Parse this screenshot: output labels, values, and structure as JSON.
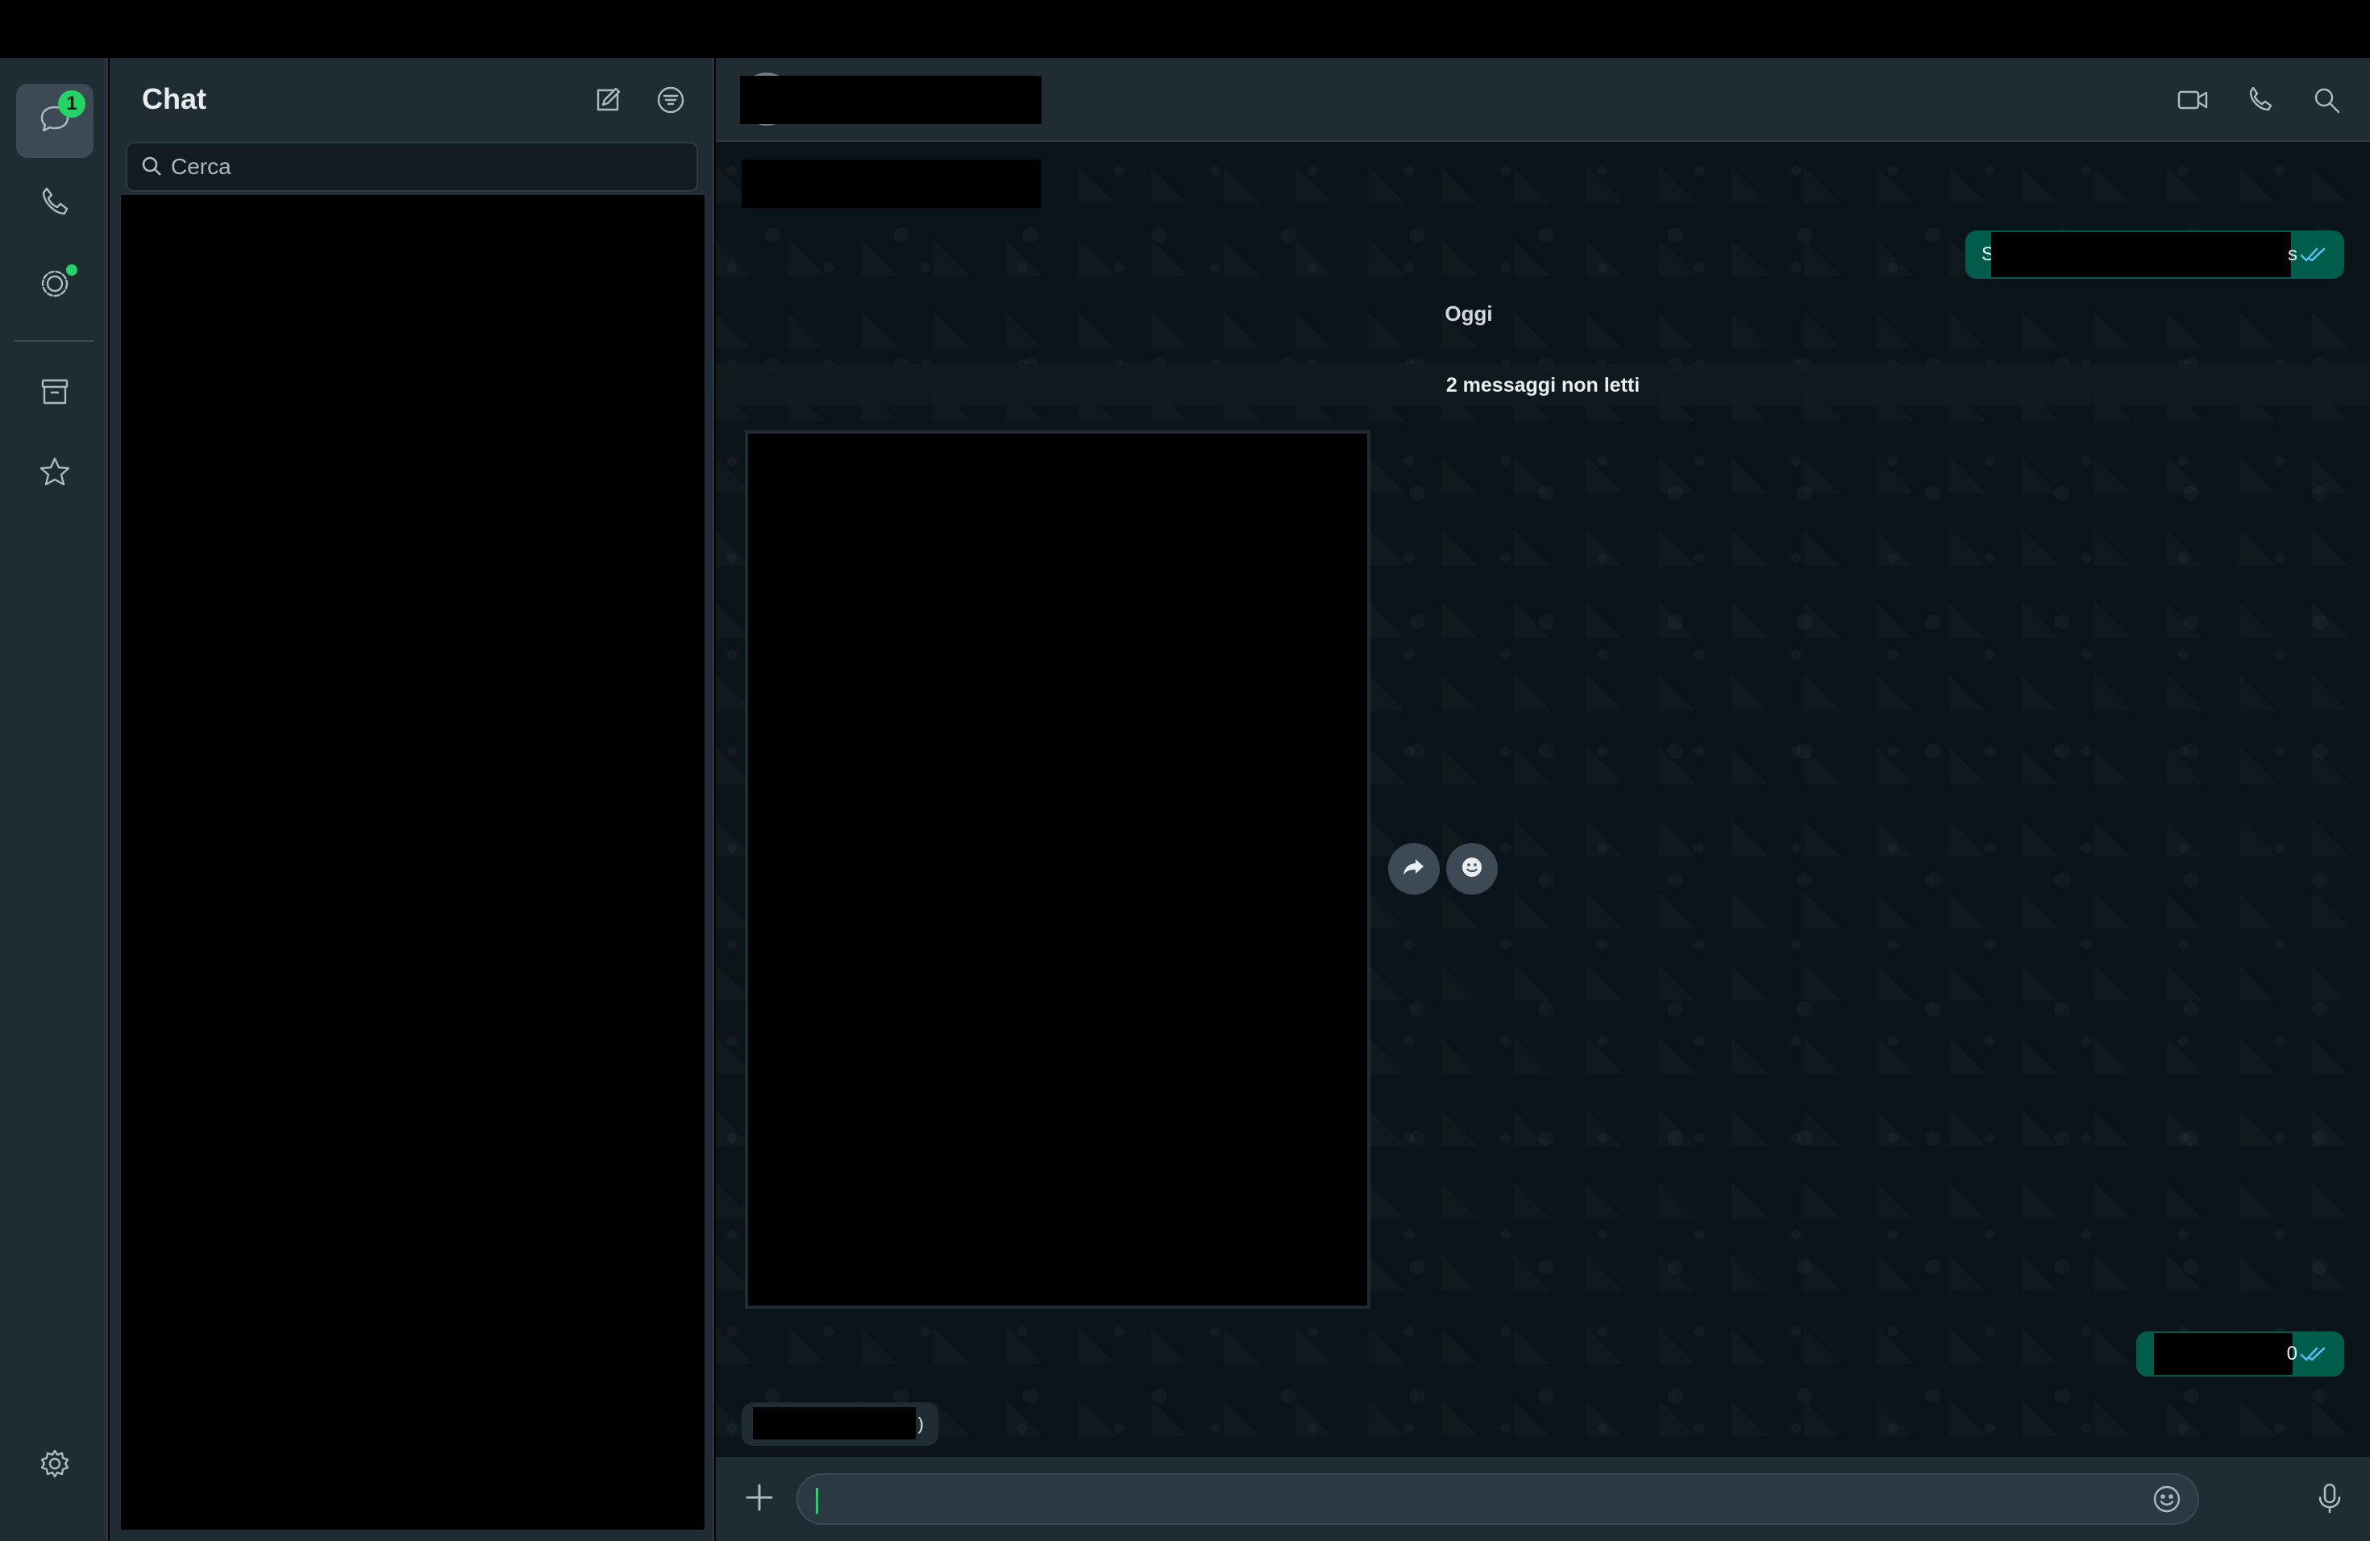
{
  "sidebar": {
    "chats_unread_badge": "1",
    "items": [
      {
        "name": "chats",
        "icon": "chat-bubble-icon"
      },
      {
        "name": "calls",
        "icon": "phone-icon"
      },
      {
        "name": "status",
        "icon": "status-ring-icon"
      },
      {
        "name": "archived",
        "icon": "archive-icon"
      },
      {
        "name": "starred",
        "icon": "star-icon"
      },
      {
        "name": "settings",
        "icon": "gear-icon"
      }
    ]
  },
  "chat_list": {
    "title": "Chat",
    "search_placeholder": "Cerca"
  },
  "conversation": {
    "date_separator": "Oggi",
    "unread_banner": "2 messaggi non letti",
    "outgoing_1_visible_start": "S",
    "outgoing_1_visible_end": "s",
    "outgoing_2_visible_end": "0",
    "incoming_1_visible_end": ")"
  },
  "colors": {
    "accent_green": "#25d366",
    "outgoing_bubble": "#005c4b",
    "read_tick_blue": "#53bdeb",
    "panel_bg": "#202c33",
    "chat_bg": "#0b141a"
  }
}
